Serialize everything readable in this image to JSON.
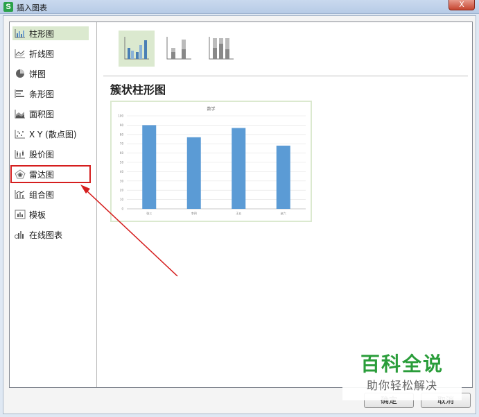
{
  "window": {
    "title": "插入图表",
    "app_icon_letter": "S",
    "close_label": "X"
  },
  "sidebar": {
    "items": [
      {
        "label": "柱形图",
        "icon": "column-chart-icon",
        "selected": true
      },
      {
        "label": "折线图",
        "icon": "line-chart-icon"
      },
      {
        "label": "饼图",
        "icon": "pie-chart-icon"
      },
      {
        "label": "条形图",
        "icon": "bar-chart-icon"
      },
      {
        "label": "面积图",
        "icon": "area-chart-icon"
      },
      {
        "label": "X Y (散点图)",
        "icon": "scatter-chart-icon"
      },
      {
        "label": "股价图",
        "icon": "stock-chart-icon"
      },
      {
        "label": "雷达图",
        "icon": "radar-chart-icon",
        "highlighted": true
      },
      {
        "label": "组合图",
        "icon": "combo-chart-icon"
      },
      {
        "label": "模板",
        "icon": "template-icon"
      },
      {
        "label": "在线图表",
        "icon": "online-chart-icon"
      }
    ]
  },
  "main": {
    "subtypes": [
      "clustered-column-icon",
      "stacked-column-icon",
      "percent-stacked-column-icon"
    ],
    "chart_name": "簇状柱形图"
  },
  "chart_data": {
    "type": "bar",
    "title": "数学",
    "categories": [
      "张三",
      "李四",
      "王五",
      "赵六"
    ],
    "values": [
      90,
      77,
      87,
      68
    ],
    "ylim": [
      0,
      100
    ],
    "yticks": [
      0,
      10,
      20,
      30,
      40,
      50,
      60,
      70,
      80,
      90,
      100
    ],
    "grid": true,
    "bar_color": "#5b9bd5"
  },
  "buttons": {
    "ok_label": "确定",
    "cancel_label": "取消"
  },
  "watermark": {
    "main": "百科全说",
    "sub": "助你轻松解决"
  },
  "colors": {
    "accent_green": "#2a9d3a",
    "annotation_red": "#d51e1e",
    "selection_bg": "#dbe9cf"
  }
}
